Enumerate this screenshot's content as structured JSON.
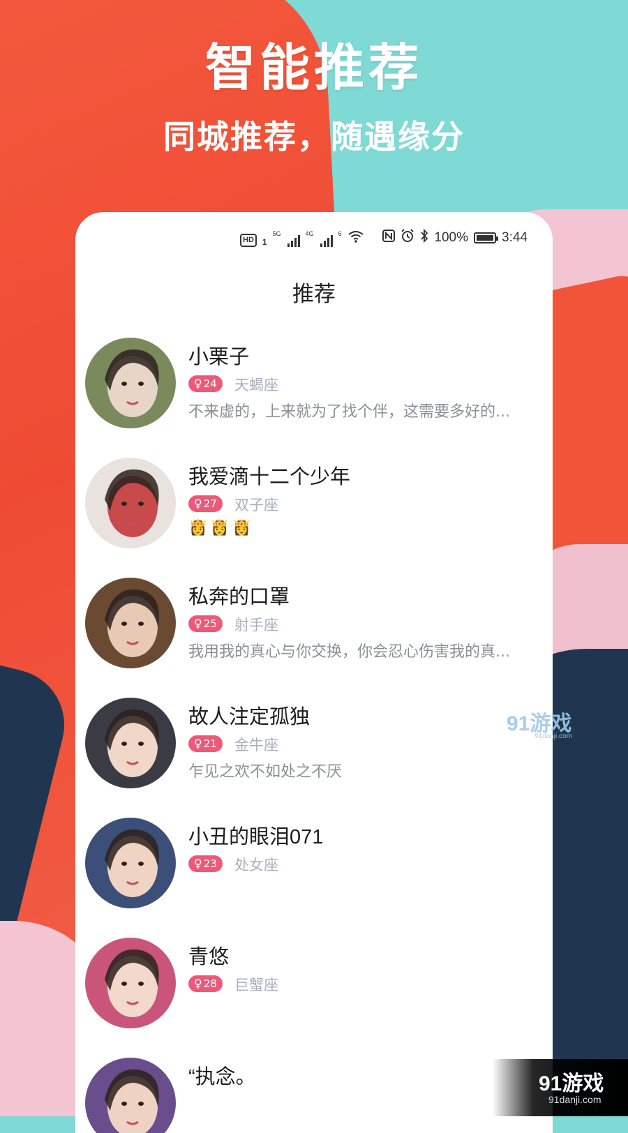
{
  "promo": {
    "headline": "智能推荐",
    "subheadline": "同城推荐，随遇缘分"
  },
  "status_bar": {
    "hd": "HD",
    "sim1": "1",
    "net1": "5G",
    "net2": "4G",
    "wifi": "6",
    "battery": "100%",
    "time": "3:44"
  },
  "screen": {
    "title": "推荐"
  },
  "users": [
    {
      "name": "小栗子",
      "gender": "♀",
      "age": "24",
      "zodiac": "天蝎座",
      "bio": "不来虚的，上来就为了找个伴，这需要多好的...",
      "avatar_colors": [
        "#7a8a5c",
        "#e7d6c8"
      ]
    },
    {
      "name": "我爱滴十二个少年",
      "gender": "♀",
      "age": "27",
      "zodiac": "双子座",
      "bio": "👸👸👸",
      "avatar_colors": [
        "#e9e2de",
        "#c84a4a"
      ]
    },
    {
      "name": "私奔的口罩",
      "gender": "♀",
      "age": "25",
      "zodiac": "射手座",
      "bio": "我用我的真心与你交换，你会忍心伤害我的真...",
      "avatar_colors": [
        "#6b4a33",
        "#e8c9b4"
      ]
    },
    {
      "name": "故人注定孤独",
      "gender": "♀",
      "age": "21",
      "zodiac": "金牛座",
      "bio": "乍见之欢不如处之不厌",
      "avatar_colors": [
        "#3b3b45",
        "#f0d7c7"
      ]
    },
    {
      "name": "小丑的眼泪071",
      "gender": "♀",
      "age": "23",
      "zodiac": "处女座",
      "bio": "",
      "avatar_colors": [
        "#3c4f78",
        "#f1d3c3"
      ]
    },
    {
      "name": "青悠",
      "gender": "♀",
      "age": "28",
      "zodiac": "巨蟹座",
      "bio": "",
      "avatar_colors": [
        "#c9567a",
        "#f3d9cb"
      ]
    },
    {
      "name": "“执念。",
      "gender": "",
      "age": "",
      "zodiac": "",
      "bio": "",
      "avatar_colors": [
        "#6a4d8c",
        "#f0d2c4"
      ]
    }
  ],
  "watermark": {
    "brand": "91游戏",
    "site": "91danji.com"
  }
}
